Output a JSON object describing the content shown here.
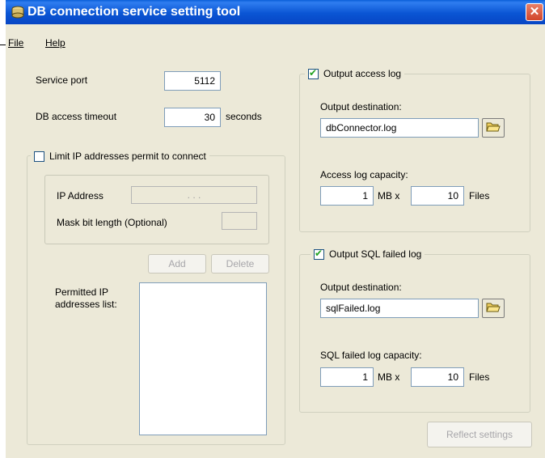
{
  "window": {
    "title": "DB connection service setting tool",
    "close_glyph": "✕"
  },
  "menu": {
    "file_label": "File",
    "help_label": "Help"
  },
  "service": {
    "port_label": "Service port",
    "port_value": "5112",
    "timeout_label": "DB access timeout",
    "timeout_value": "30",
    "timeout_unit": "seconds"
  },
  "ip_limit": {
    "checkbox_label": "Limit IP addresses permit to connect",
    "checked": false,
    "ip_address_label": "IP Address",
    "ip_dots": ".          .          .",
    "mask_label": "Mask bit length (Optional)",
    "add_label": "Add",
    "delete_label": "Delete",
    "permitted_label_line1": "Permitted IP",
    "permitted_label_line2": "addresses list:"
  },
  "access_log": {
    "checkbox_label": "Output access log",
    "checked": true,
    "destination_label": "Output destination:",
    "destination_value": "dbConnector.log",
    "capacity_label": "Access log capacity:",
    "capacity_mb": "1",
    "mb_unit": "MB x",
    "capacity_files": "10",
    "files_unit": "Files"
  },
  "sql_log": {
    "checkbox_label": "Output SQL failed log",
    "checked": true,
    "destination_label": "Output destination:",
    "destination_value": "sqlFailed.log",
    "capacity_label": "SQL failed log capacity:",
    "capacity_mb": "1",
    "mb_unit": "MB x",
    "capacity_files": "10",
    "files_unit": "Files"
  },
  "reflect_label": "Reflect settings",
  "icons": {
    "app": "database-icon",
    "folder": "folder-open-icon",
    "close": "close-icon"
  },
  "colors": {
    "titlebar": "#0a55d4",
    "dialog_bg": "#ece9d8",
    "close_button": "#d1452a",
    "check_mark": "#21a121"
  }
}
